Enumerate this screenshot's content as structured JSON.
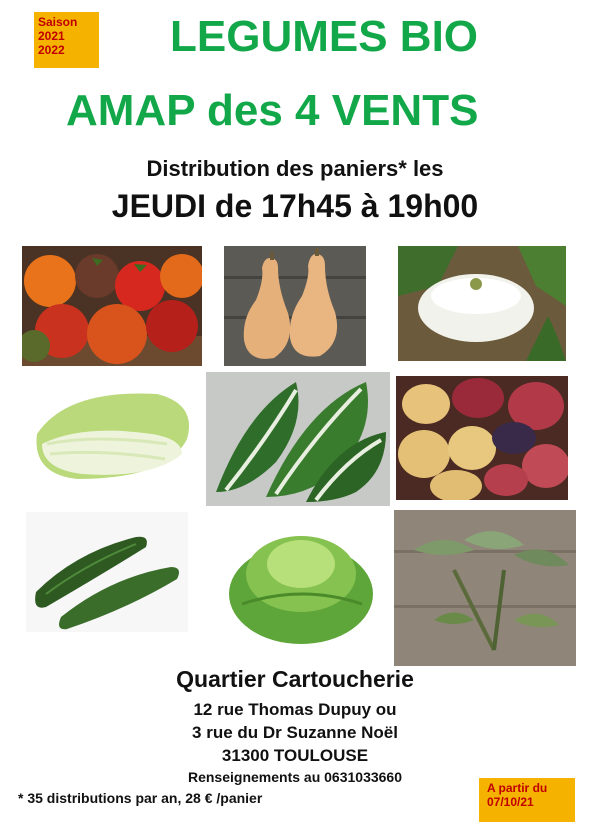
{
  "season_badge": {
    "line1": "Saison",
    "line2": "2021",
    "line3": "2022"
  },
  "title": {
    "line1": "LEGUMES BIO",
    "line2": "AMAP des 4 VENTS"
  },
  "distribution": {
    "line1": "Distribution des paniers* les",
    "line2": "JEUDI de 17h45 à 19h00"
  },
  "address": {
    "title": "Quartier Cartoucherie",
    "line1": "12 rue Thomas Dupuy ou",
    "line2": "3 rue du Dr Suzanne Noël",
    "line3": "31300 TOULOUSE"
  },
  "info": "Renseignements au 0631033660",
  "note": "* 35 distributions par an, 28 € /panier",
  "start_badge": {
    "line1": "A partir du",
    "line2": "07/10/21"
  },
  "colors": {
    "title_green": "#12a84a",
    "badge_bg": "#f5b300",
    "badge_text": "#c00000"
  }
}
